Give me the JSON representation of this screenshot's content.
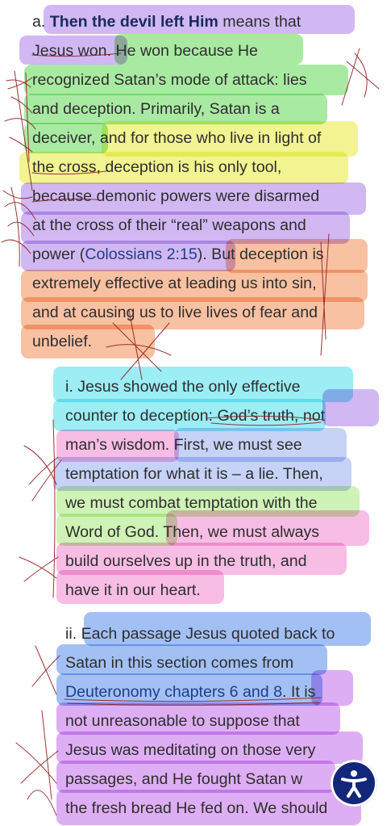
{
  "colors": {
    "purple": "#c7a8f0",
    "green": "#96e68e",
    "yellow": "#eff27a",
    "orange": "#f7b48e",
    "cyan": "#86e9f2",
    "pink": "#f6aee0",
    "lightgreen": "#c4f0a6",
    "blue": "#8fb2f2",
    "violet": "#d79cf2",
    "ink": "#8e1f22"
  },
  "section_a": {
    "prefix": "a. ",
    "bold": "Then the devil left Him",
    "l1_rest": " means that",
    "l2a": "Jesus won",
    "l2b": ". He won because He",
    "l3": "recognized Satan’s mode of attack: lies",
    "l4": "and deception. Primarily, Satan is a",
    "l5": "deceiver, and for those who live in light of",
    "l6": "the cross, deception is his only tool,",
    "l7": "because demonic powers were disarmed",
    "l8": "at the cross of their “real” weapons and",
    "l9a": "power (",
    "l9link": "Colossians 2:15",
    "l9b": "). But deception is",
    "l10": "extremely effective at leading us into sin,",
    "l11": "and at causing us to live lives of fear and",
    "l12": "unbelief."
  },
  "section_i": {
    "l1": "i. Jesus showed the only effective",
    "l2": "counter to deception: God’s truth, not",
    "l3": "man’s wisdom. First, we must see",
    "l4": "temptation for what it is – a lie. Then,",
    "l5": "we must combat temptation with the",
    "l6": "Word of God. Then, we must always",
    "l7": "build ourselves up in the truth, and",
    "l8": "have it in our heart."
  },
  "section_ii": {
    "l1": "ii. Each passage Jesus quoted back to",
    "l2": "Satan in this section comes from",
    "l3link": "Deuteronomy chapters 6 and 8",
    "l3b": ". It is",
    "l4": "not unreasonable to suppose that",
    "l5": "Jesus was meditating on those very",
    "l6": "passages, and He fought Satan w",
    "l7": "the fresh bread He fed on. We should"
  },
  "accessibility_button": {
    "icon": "accessibility-icon"
  }
}
